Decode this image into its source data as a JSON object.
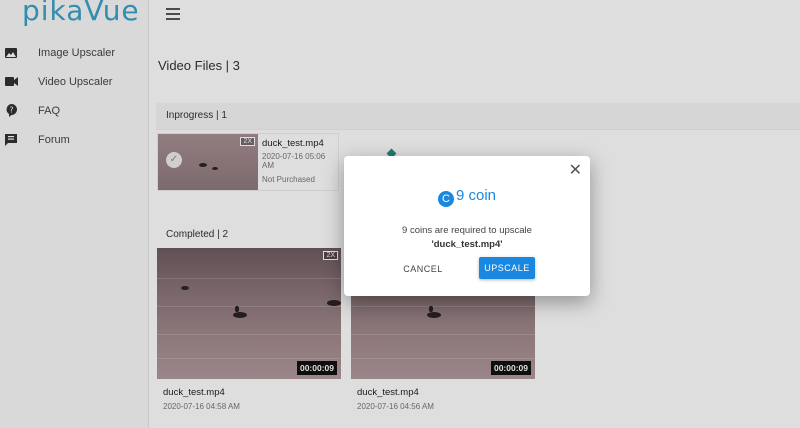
{
  "app": {
    "logo": "pikaVue"
  },
  "sidebar": {
    "items": [
      {
        "label": "Image Upscaler",
        "icon": "image-icon"
      },
      {
        "label": "Video Upscaler",
        "icon": "video-camera-icon"
      },
      {
        "label": "FAQ",
        "icon": "question-icon"
      },
      {
        "label": "Forum",
        "icon": "forum-icon"
      }
    ]
  },
  "main": {
    "title": "Video Files | 3",
    "inprogress": {
      "header": "Inprogress | 1",
      "item": {
        "name": "duck_test.mp4",
        "date": "2020-07-16 05:06 AM",
        "status": "Not Purchased",
        "badge": "2X"
      }
    },
    "completed": {
      "header": "Completed | 2",
      "items": [
        {
          "name": "duck_test.mp4",
          "date": "2020-07-16 04:58 AM",
          "duration": "00:00:09",
          "badge": "2X"
        },
        {
          "name": "duck_test.mp4",
          "date": "2020-07-16 04:56 AM",
          "duration": "00:00:09"
        }
      ]
    }
  },
  "modal": {
    "coin_symbol": "C",
    "coin_text": "9 coin",
    "message": "9 coins are required to upscale",
    "filename": "'duck_test.mp4'",
    "cancel_label": "CANCEL",
    "upscale_label": "UPSCALE",
    "close_symbol": "✕"
  },
  "colors": {
    "accent": "#1a88e0",
    "logo": "#3aa3c8"
  }
}
